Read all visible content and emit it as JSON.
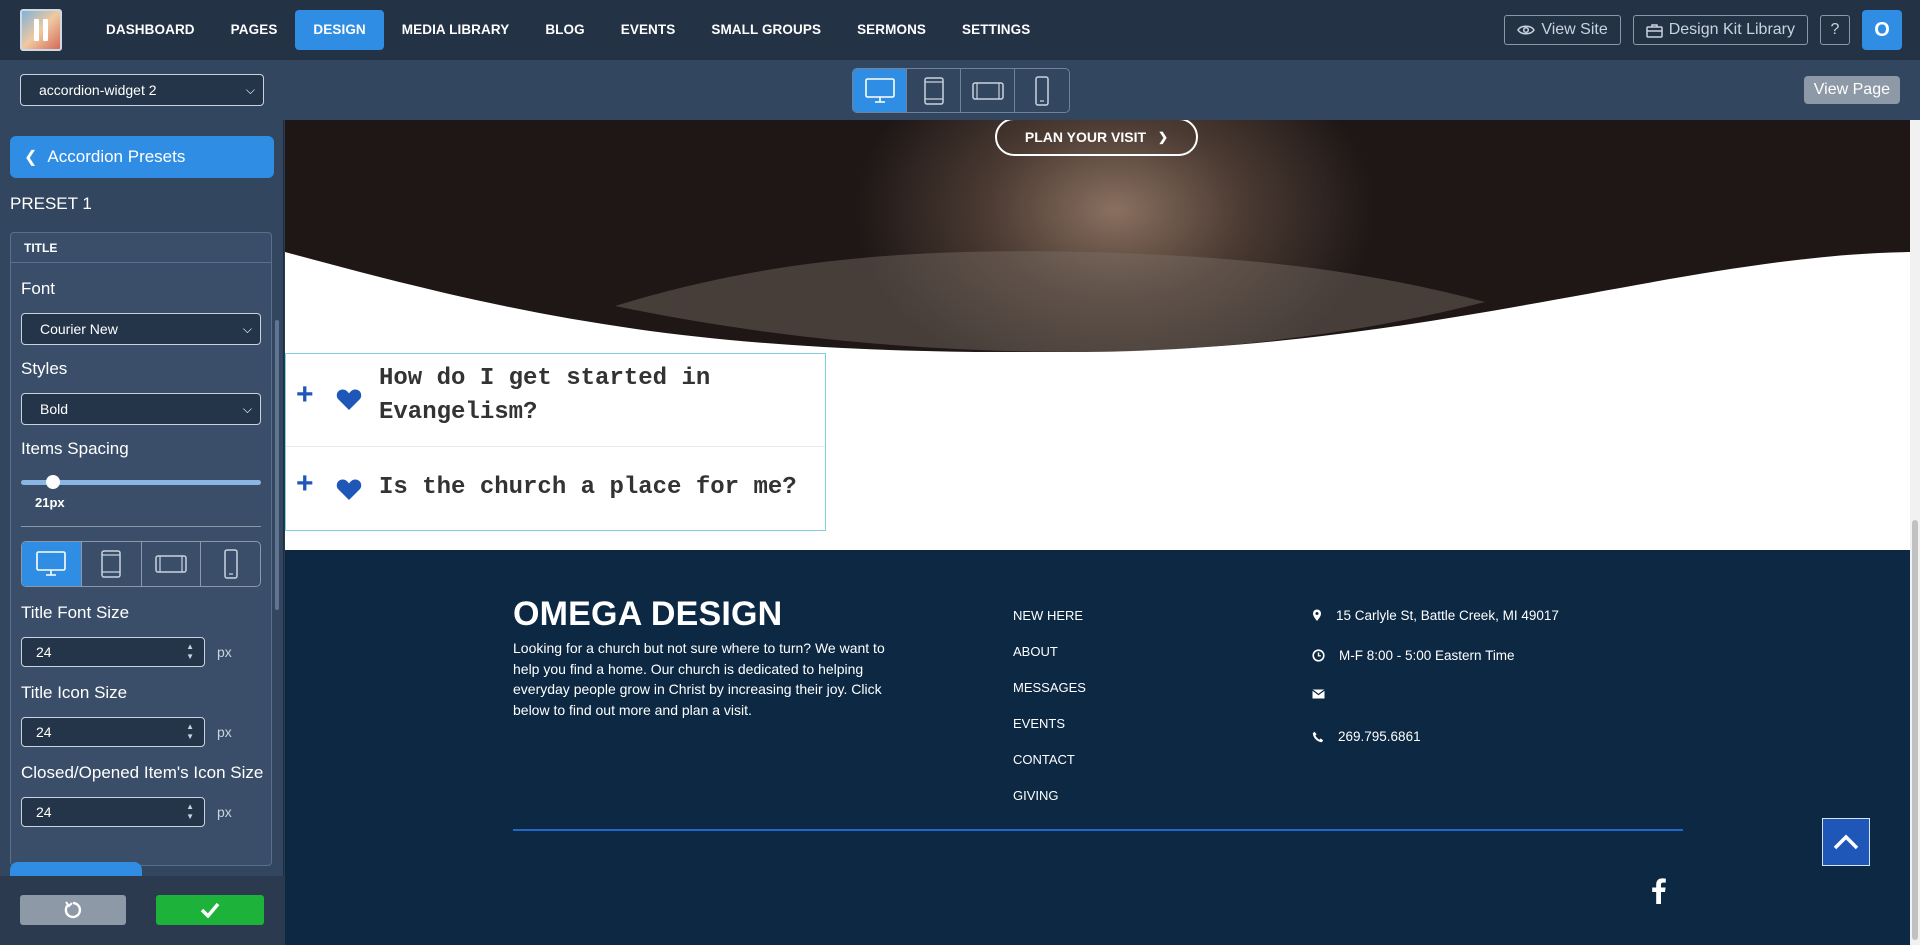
{
  "nav": {
    "items": [
      "DASHBOARD",
      "PAGES",
      "DESIGN",
      "MEDIA LIBRARY",
      "BLOG",
      "EVENTS",
      "SMALL GROUPS",
      "SERMONS",
      "SETTINGS"
    ],
    "active": "DESIGN",
    "view_site": "View Site",
    "design_kit": "Design Kit Library",
    "help": "?",
    "avatar": "O"
  },
  "toolbar": {
    "widget_select": "accordion-widget 2",
    "devices": [
      "desktop-icon",
      "tablet-portrait-icon",
      "tablet-landscape-icon",
      "phone-icon"
    ],
    "active_device": "desktop-icon",
    "view_page": "View Page"
  },
  "sidebar": {
    "presets_button": "Accordion Presets",
    "preset_label": "PRESET 1",
    "panel_title": "TITLE",
    "font_label": "Font",
    "font_value": "Courier New",
    "styles_label": "Styles",
    "styles_value": "Bold",
    "spacing_label": "Items Spacing",
    "spacing_value": "21px",
    "spacing_fraction": 0.1,
    "title_font_size_label": "Title Font Size",
    "title_font_size": "24",
    "title_icon_size_label": "Title Icon Size",
    "title_icon_size": "24",
    "item_icon_size_label": "Closed/Opened Item's Icon Size",
    "item_icon_size": "24",
    "unit": "px"
  },
  "preview": {
    "plan_button": "PLAN YOUR VISIT",
    "accordion": [
      {
        "title_line1": "How do I get started in",
        "title_line2": "Evangelism?"
      },
      {
        "title_line1": "Is the church a place for me?"
      }
    ],
    "footer": {
      "title": "OMEGA DESIGN",
      "description": "Looking for a church but not sure where to turn? We want to help you find a home. Our church is dedicated to helping everyday people grow in Christ by increasing their joy.  Click below to find out more and plan a visit.",
      "links": [
        "NEW HERE",
        "ABOUT",
        "MESSAGES",
        "EVENTS",
        "CONTACT",
        "GIVING"
      ],
      "address": "15 Carlyle St, Battle Creek, MI 49017",
      "hours": "M-F 8:00 - 5:00 Eastern Time",
      "email": "",
      "phone": "269.795.6861"
    }
  },
  "colors": {
    "accent": "#2f8de4",
    "accordion_icon": "#1f57b8",
    "footer_bg": "#0c2842",
    "confirm": "#1db33a"
  }
}
